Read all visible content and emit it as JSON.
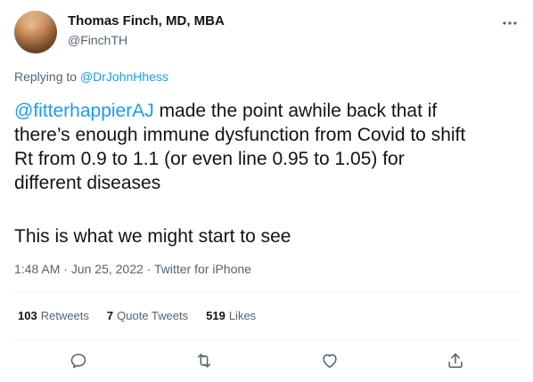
{
  "author": {
    "name": "Thomas Finch, MD, MBA",
    "handle": "@FinchTH",
    "avatar_icon": "user-avatar-photo"
  },
  "reply": {
    "prefix": "Replying to ",
    "target": "@DrJohnHhess"
  },
  "body": {
    "mention": "@fitterhappierAJ",
    "line1_rest": " made the point awhile back that if",
    "line2": "there’s enough immune dysfunction from Covid to shift",
    "line3": "Rt from 0.9 to 1.1 (or even line 0.95 to 1.05) for",
    "line4": "different diseases",
    "paragraph2": "This is what we might start to see"
  },
  "meta": {
    "time": "1:48 AM",
    "separator1": " · ",
    "date": "Jun 25, 2022",
    "separator2": " · ",
    "source": "Twitter for iPhone"
  },
  "stats": {
    "retweets_count": "103",
    "retweets_label": "Retweets",
    "quotes_count": "7",
    "quotes_label": "Quote Tweets",
    "likes_count": "519",
    "likes_label": "Likes"
  },
  "actions": {
    "reply_icon": "reply-icon",
    "retweet_icon": "retweet-icon",
    "like_icon": "heart-icon",
    "share_icon": "share-icon",
    "more_icon": "more-options-icon"
  },
  "colors": {
    "link": "#1d9bf0",
    "text": "#0f1419",
    "secondary": "#536471",
    "divider": "#eff3f4"
  }
}
